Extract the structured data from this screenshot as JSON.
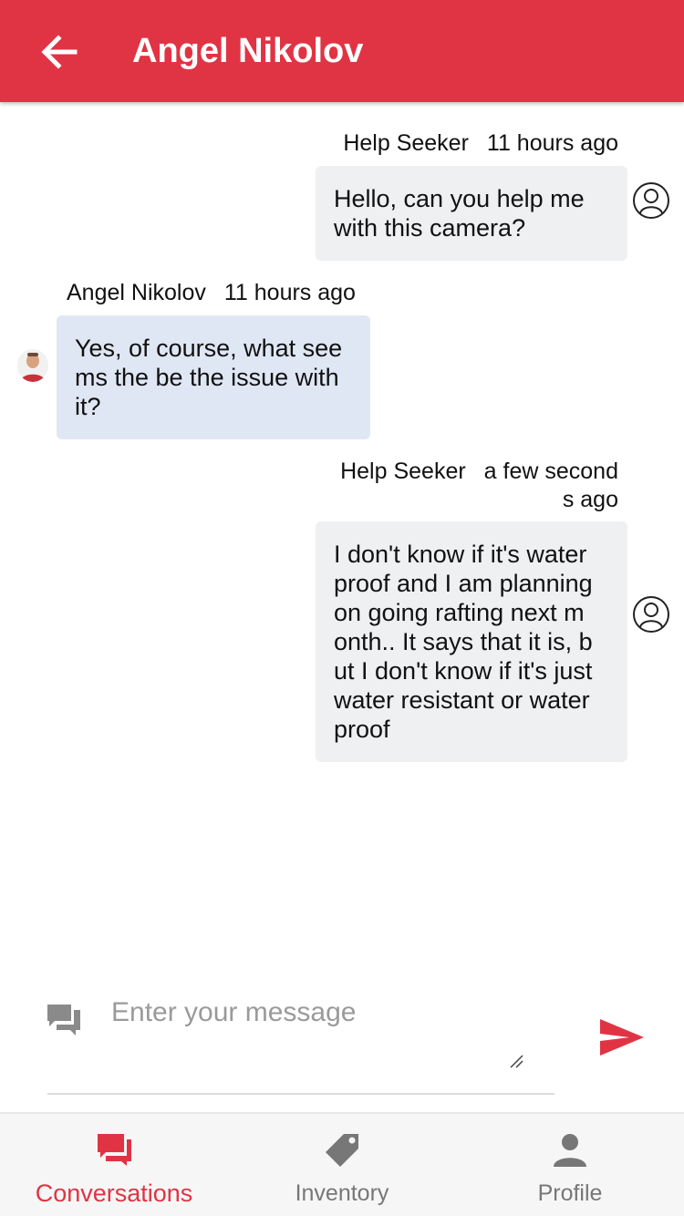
{
  "header": {
    "title": "Angel Nikolov",
    "back_icon": "arrow-left-icon"
  },
  "messages": [
    {
      "sender": "Help Seeker",
      "time": "11 hours ago",
      "text": "Hello, can you help me\nwith this camera?",
      "direction": "outgoing"
    },
    {
      "sender": "Angel Nikolov",
      "time": "11 hours ago",
      "text": "Yes, of course, what see\nms the be the issue with\nit?",
      "direction": "incoming"
    },
    {
      "sender": "Help Seeker",
      "time": "a few second\ns ago",
      "text": "I don't know if it's water\nproof and I am planning\non going rafting next m\nonth.. It says that it is, b\nut I don't know if it's just\nwater resistant or water\nproof",
      "direction": "outgoing"
    }
  ],
  "composer": {
    "placeholder": "Enter your message",
    "value": "",
    "chat_icon": "chat-bubbles-icon",
    "send_icon": "send-icon"
  },
  "nav": {
    "items": [
      {
        "label": "Conversations",
        "icon": "chat-icon",
        "active": true
      },
      {
        "label": "Inventory",
        "icon": "tag-icon",
        "active": false
      },
      {
        "label": "Profile",
        "icon": "person-icon",
        "active": false
      }
    ]
  },
  "colors": {
    "accent": "#e03444",
    "outgoing_bubble": "#eff0f2",
    "incoming_bubble": "#e0e7f4",
    "inactive_nav": "#777777"
  }
}
